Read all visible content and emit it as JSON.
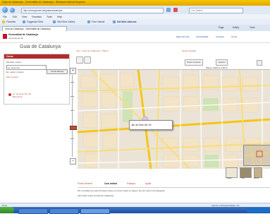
{
  "window": {
    "title": "Guia de Catalunya - Generalitat de Catalunya - Windows Internet Explorer"
  },
  "browser": {
    "address": "http://www.gencat.cat/guiadecatalunya/...",
    "search_placeholder": "Live Search",
    "menus": [
      "File",
      "Edit",
      "View",
      "Favorites",
      "Tools",
      "Help"
    ],
    "favorites": [
      "Favorites",
      "Suggested Sites",
      "Web Slice Gallery",
      "Free Hotmail",
      "Get More Add-ons"
    ],
    "tab_label": "Guia de Catalunya - Generalitat de Catalunya",
    "commands": [
      "Page",
      "Safety",
      "Tools"
    ]
  },
  "site": {
    "org_name": "Generalitat de Catalunya",
    "org_url": "www.gencat.cat",
    "top_links": [
      "Mapa del web",
      "Accessibilitat",
      "Contacte",
      "Cerca"
    ]
  },
  "page": {
    "title": "Guia de Catalunya",
    "breadcrumb": "Inici > Guia de Catalunya > Plànol",
    "user_text": "Sessió iniciada"
  },
  "left_panel": {
    "header": "Cerca",
    "label1": "Municipi / carrer",
    "input_value": "Av. Gran Via",
    "hint1": "Ex: carrer, número",
    "search_button": "Cerca adreça",
    "hint2": "Més opcions",
    "result_link_line1": "Av. de Gran Via, 50",
    "result_link_line2": "Barcelona"
  },
  "map": {
    "tool_buttons": [
      "Punts d'interès",
      "Imprimir"
    ],
    "view_tabs": "Mapa | Satèl·lit | Híbrid",
    "popup_text": "Av. de Gran Via, 50",
    "popup_close": "x",
    "zoom_in": "+",
    "zoom_out": "−",
    "thumb_labels": [
      "Mapa",
      "Orto",
      "Híbrid"
    ]
  },
  "bottom": {
    "tabs": [
      "Punts d'interès",
      "Com arribar",
      "Enllaços",
      "Ajuda"
    ],
    "active_tab_index": 1,
    "text1": "Per consultar els punts d'interès situeu el cursor sobre el mapa o feu clic sobre una categoria.",
    "text2": "Informació sobre la Guia de Catalunya"
  },
  "status": {
    "left": "Done",
    "right": "Internet | Protected Mode: On"
  },
  "colors": {
    "accent": "#b32b2b",
    "link": "#b5523a",
    "chrome_top": "#f6c800",
    "taskbar": "#1e4fa3"
  }
}
